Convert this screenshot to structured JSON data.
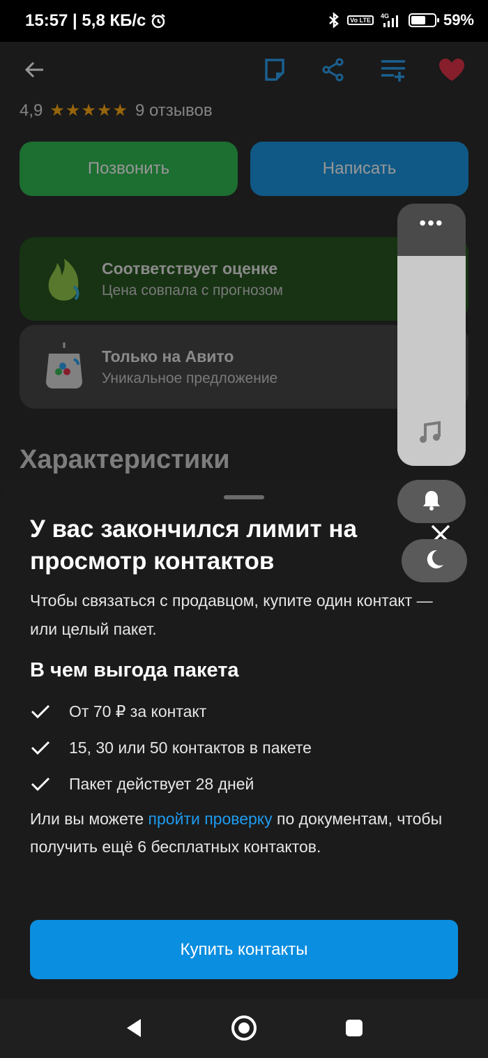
{
  "status_bar": {
    "time_and_speed": "15:57 | 5,8 КБ/с",
    "network": "4G",
    "volte": "Vo LTE",
    "battery": "59%"
  },
  "toolbar": {
    "icons": [
      "back-arrow-icon",
      "note-icon",
      "share-icon",
      "add-to-list-icon",
      "favorite-heart-icon"
    ],
    "heart_color": "#e0243d"
  },
  "rating": {
    "value": "4,9",
    "stars": "★★★★★",
    "reviews": "9 отзывов"
  },
  "actions": {
    "call_label": "Позвонить",
    "write_label": "Написать"
  },
  "badges": [
    {
      "title": "Соответствует оценке",
      "subtitle": "Цена совпала с прогнозом"
    },
    {
      "title": "Только на Авито",
      "subtitle": "Уникальное предложение"
    }
  ],
  "section_title": "Характеристики",
  "volume_panel": {
    "more": "•••",
    "level": 0.8
  },
  "sheet": {
    "title": "У вас закончился лимит на просмотр контактов",
    "description": "Чтобы связаться с продавцом, купите один контакт — или целый пакет.",
    "benefits_title": "В чем выгода пакета",
    "benefits": [
      "От 70 ₽ за контакт",
      "15, 30 или 50 контактов в пакете",
      "Пакет действует 28 дней"
    ],
    "verify_prefix": "Или вы можете ",
    "verify_link": "пройти проверку",
    "verify_suffix": " по документам, чтобы получить ещё 6 бесплатных контактов.",
    "buy_label": "Купить контакты"
  },
  "colors": {
    "accent_blue": "#0a8ee0",
    "call_green": "#21b446",
    "link_blue": "#1e9bf0"
  }
}
